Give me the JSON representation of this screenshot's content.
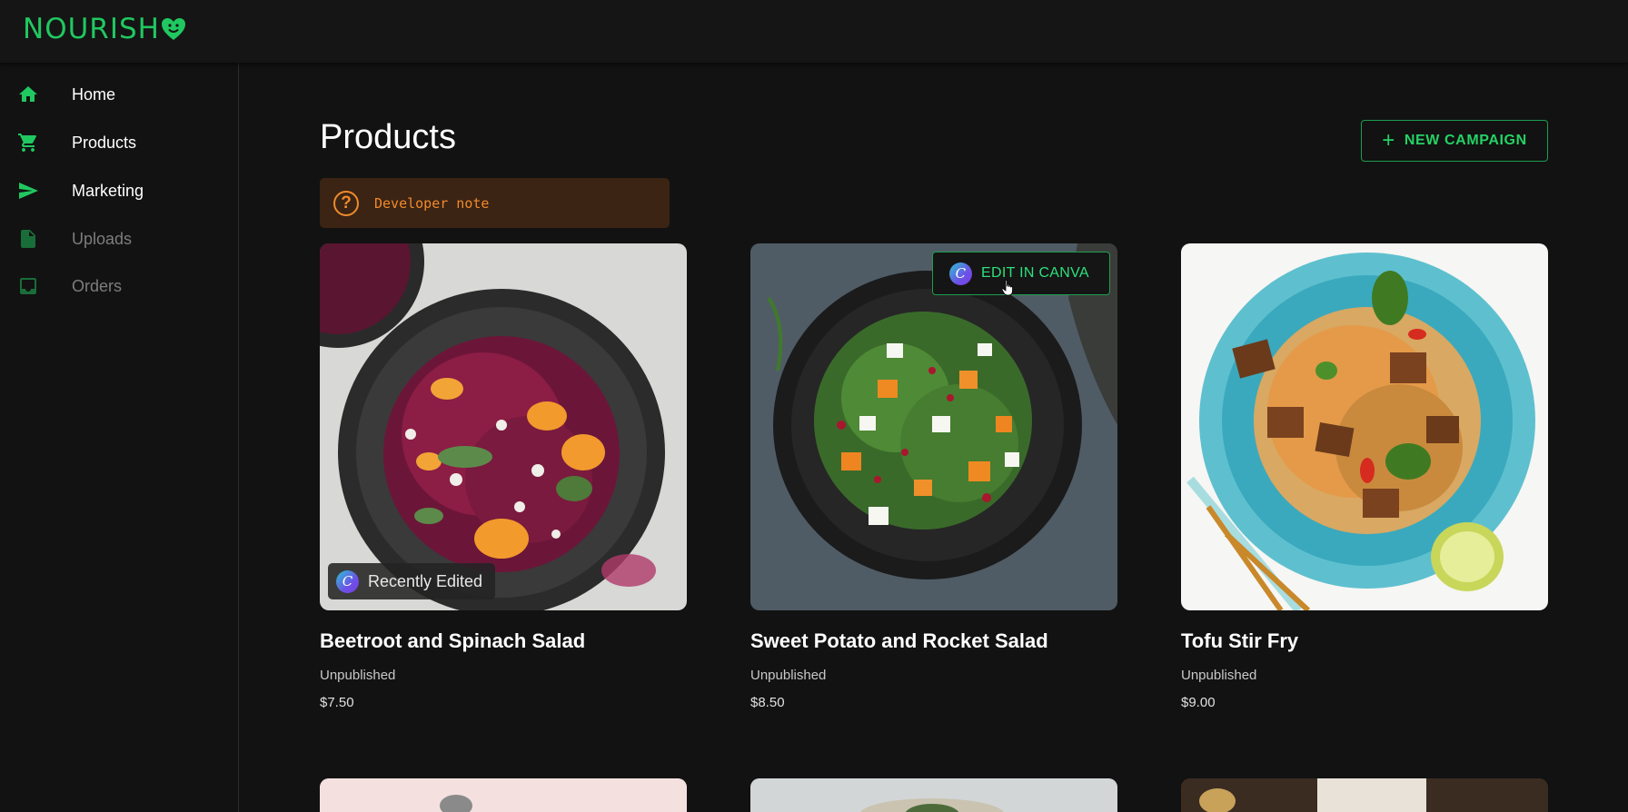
{
  "app": {
    "logo_text": "NOURISH",
    "brand_color": "#20c860"
  },
  "sidebar": {
    "items": [
      {
        "label": "Home",
        "icon": "home-icon",
        "enabled": true
      },
      {
        "label": "Products",
        "icon": "cart-icon",
        "enabled": true
      },
      {
        "label": "Marketing",
        "icon": "send-icon",
        "enabled": true
      },
      {
        "label": "Uploads",
        "icon": "file-upload-icon",
        "enabled": false
      },
      {
        "label": "Orders",
        "icon": "inbox-icon",
        "enabled": false
      }
    ]
  },
  "main": {
    "title": "Products",
    "new_campaign_label": "NEW CAMPAIGN",
    "developer_note": "Developer note",
    "products": [
      {
        "name": "Beetroot and Spinach Salad",
        "status": "Unpublished",
        "price": "$7.50",
        "badge": "Recently Edited"
      },
      {
        "name": "Sweet Potato and Rocket Salad",
        "status": "Unpublished",
        "price": "$8.50",
        "action": "EDIT IN CANVA"
      },
      {
        "name": "Tofu Stir Fry",
        "status": "Unpublished",
        "price": "$9.00"
      }
    ]
  },
  "icons": {
    "canva_letter": "C"
  }
}
